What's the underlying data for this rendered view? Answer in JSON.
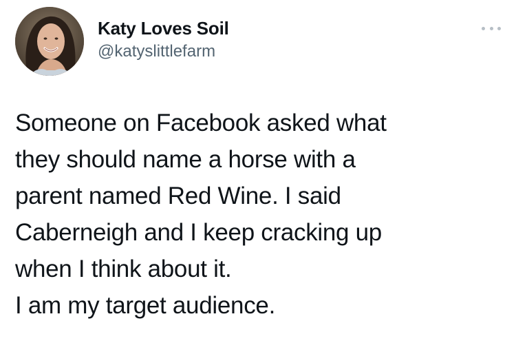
{
  "author": {
    "display_name": "Katy Loves Soil",
    "handle": "@katyslittlefarm",
    "avatar_icon": "profile-photo"
  },
  "menu": {
    "icon": "more-options-icon"
  },
  "tweet": {
    "lines": [
      "Someone on Facebook asked what",
      "they should name a horse with a",
      "parent named Red Wine. I said",
      "Caberneigh and I keep cracking up",
      "when I think about it.",
      "I am my target audience."
    ]
  },
  "colors": {
    "text": "#0f1419",
    "secondary": "#536471",
    "background": "#ffffff"
  }
}
